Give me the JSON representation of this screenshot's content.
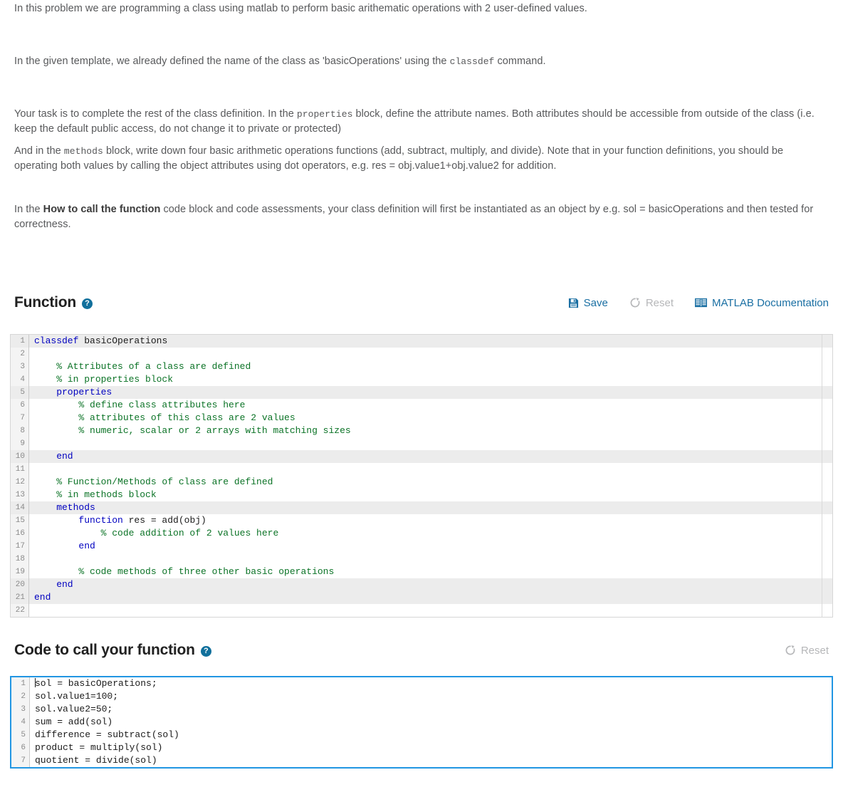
{
  "problem": {
    "paragraphs": [
      {
        "id": "p1",
        "parts": [
          {
            "type": "text",
            "text": "In this problem we are programming a class using matlab to perform basic arithematic operations with 2 user-defined values."
          }
        ]
      },
      {
        "id": "p2",
        "parts": [
          {
            "type": "text",
            "text": "In the given template, we already defined the name of the class as 'basicOperations' using the "
          },
          {
            "type": "mono",
            "text": "classdef"
          },
          {
            "type": "text",
            "text": " command."
          }
        ]
      },
      {
        "id": "p3",
        "parts": [
          {
            "type": "text",
            "text": "Your task is to complete the rest of the class definition. In the "
          },
          {
            "type": "mono",
            "text": "properties"
          },
          {
            "type": "text",
            "text": " block, define the attribute names. Both attributes should be accessible from outside of the class (i.e. keep the default public access, do not change it to private or protected)"
          }
        ]
      },
      {
        "id": "p4",
        "parts": [
          {
            "type": "text",
            "text": "And in the "
          },
          {
            "type": "mono",
            "text": "methods"
          },
          {
            "type": "text",
            "text": " block, write down four basic arithmetic operations functions (add, subtract, multiply, and divide). Note that in your function definitions, you should be operating both values by calling the object attributes using dot operators, e.g. res = obj.value1+obj.value2 for addition."
          }
        ]
      },
      {
        "id": "p5",
        "parts": [
          {
            "type": "text",
            "text": "In the "
          },
          {
            "type": "bold",
            "text": "How to call the function"
          },
          {
            "type": "text",
            "text": " code block and code assessments, your class definition will first be instantiated as an object by e.g.  sol = basicOperations and then tested for correctness."
          }
        ]
      }
    ]
  },
  "function_section": {
    "title": "Function",
    "help_icon": "question-circle-icon",
    "toolbar": {
      "save": {
        "label": "Save",
        "icon": "floppy-disk-icon",
        "disabled": false
      },
      "reset": {
        "label": "Reset",
        "icon": "refresh-icon",
        "disabled": true
      },
      "docs": {
        "label": "MATLAB Documentation",
        "icon": "book-icon",
        "disabled": false
      }
    },
    "editor": {
      "lines": [
        {
          "n": "1",
          "highlight": true,
          "tokens": [
            {
              "t": "kw",
              "s": "classdef"
            },
            {
              "t": "plain",
              "s": " basicOperations"
            }
          ]
        },
        {
          "n": "2",
          "highlight": false,
          "tokens": []
        },
        {
          "n": "3",
          "highlight": false,
          "tokens": [
            {
              "t": "cmt",
              "s": "    % Attributes of a class are defined"
            }
          ]
        },
        {
          "n": "4",
          "highlight": false,
          "tokens": [
            {
              "t": "cmt",
              "s": "    % in properties block"
            }
          ]
        },
        {
          "n": "5",
          "highlight": true,
          "tokens": [
            {
              "t": "kw",
              "s": "    properties"
            }
          ]
        },
        {
          "n": "6",
          "highlight": false,
          "tokens": [
            {
              "t": "cmt",
              "s": "        % define class attributes here"
            }
          ]
        },
        {
          "n": "7",
          "highlight": false,
          "tokens": [
            {
              "t": "cmt",
              "s": "        % attributes of this class are 2 values"
            }
          ]
        },
        {
          "n": "8",
          "highlight": false,
          "tokens": [
            {
              "t": "cmt",
              "s": "        % numeric, scalar or 2 arrays with matching sizes"
            }
          ]
        },
        {
          "n": "9",
          "highlight": false,
          "tokens": []
        },
        {
          "n": "10",
          "highlight": true,
          "tokens": [
            {
              "t": "kw",
              "s": "    end"
            }
          ]
        },
        {
          "n": "11",
          "highlight": false,
          "tokens": []
        },
        {
          "n": "12",
          "highlight": false,
          "tokens": [
            {
              "t": "cmt",
              "s": "    % Function/Methods of class are defined"
            }
          ]
        },
        {
          "n": "13",
          "highlight": false,
          "tokens": [
            {
              "t": "cmt",
              "s": "    % in methods block"
            }
          ]
        },
        {
          "n": "14",
          "highlight": true,
          "tokens": [
            {
              "t": "kw",
              "s": "    methods"
            }
          ]
        },
        {
          "n": "15",
          "highlight": false,
          "tokens": [
            {
              "t": "kw",
              "s": "        function"
            },
            {
              "t": "plain",
              "s": " res = add(obj)"
            }
          ]
        },
        {
          "n": "16",
          "highlight": false,
          "tokens": [
            {
              "t": "cmt",
              "s": "            % code addition of 2 values here"
            }
          ]
        },
        {
          "n": "17",
          "highlight": false,
          "tokens": [
            {
              "t": "kw",
              "s": "        end"
            }
          ]
        },
        {
          "n": "18",
          "highlight": false,
          "tokens": []
        },
        {
          "n": "19",
          "highlight": false,
          "tokens": [
            {
              "t": "cmt",
              "s": "        % code methods of three other basic operations"
            }
          ]
        },
        {
          "n": "20",
          "highlight": true,
          "tokens": [
            {
              "t": "kw",
              "s": "    end"
            }
          ]
        },
        {
          "n": "21",
          "highlight": true,
          "tokens": [
            {
              "t": "kw",
              "s": "end"
            }
          ]
        },
        {
          "n": "22",
          "highlight": false,
          "tokens": []
        }
      ]
    }
  },
  "call_section": {
    "title": "Code to call your function",
    "help_icon": "question-circle-icon",
    "toolbar": {
      "reset": {
        "label": "Reset",
        "icon": "refresh-icon",
        "disabled": true
      }
    },
    "editor": {
      "focused": true,
      "caret_line": 1,
      "lines": [
        {
          "n": "1",
          "highlight": false,
          "caret": true,
          "tokens": [
            {
              "t": "plain",
              "s": "sol = basicOperations;"
            }
          ]
        },
        {
          "n": "2",
          "highlight": false,
          "caret": false,
          "tokens": [
            {
              "t": "plain",
              "s": "sol.value1=100;"
            }
          ]
        },
        {
          "n": "3",
          "highlight": false,
          "caret": false,
          "tokens": [
            {
              "t": "plain",
              "s": "sol.value2=50;"
            }
          ]
        },
        {
          "n": "4",
          "highlight": false,
          "caret": false,
          "tokens": [
            {
              "t": "plain",
              "s": "sum = add(sol)"
            }
          ]
        },
        {
          "n": "5",
          "highlight": false,
          "caret": false,
          "tokens": [
            {
              "t": "plain",
              "s": "difference = subtract(sol)"
            }
          ]
        },
        {
          "n": "6",
          "highlight": false,
          "caret": false,
          "tokens": [
            {
              "t": "plain",
              "s": "product = multiply(sol)"
            }
          ]
        },
        {
          "n": "7",
          "highlight": false,
          "caret": false,
          "tokens": [
            {
              "t": "plain",
              "s": "quotient = divide(sol)"
            }
          ]
        }
      ]
    }
  },
  "colors": {
    "link_blue": "#1a6fa3",
    "help_badge": "#11709c",
    "focus_border": "#2196e3",
    "keyword": "#0000c0",
    "comment": "#0b7326",
    "row_highlight": "#ececec",
    "gutter_bg": "#f4f4f4"
  }
}
